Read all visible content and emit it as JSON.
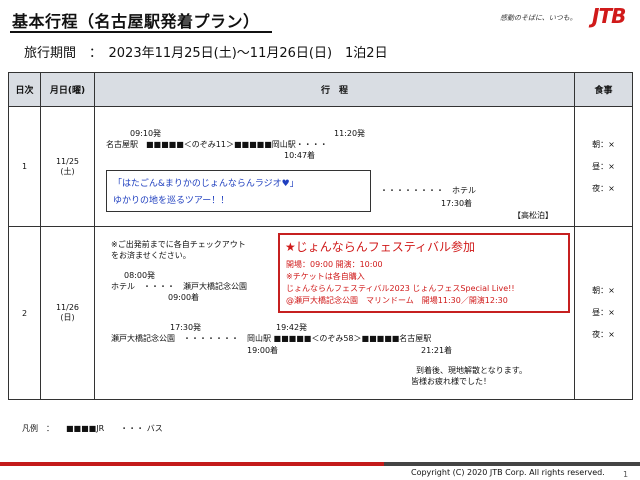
{
  "header": {
    "title": "基本行程（名古屋駅発着プラン）",
    "tagline": "感動のそばに、いつも。",
    "logo": "JTB",
    "period": "旅行期間　：　2023年11月25日(土)～11月26日(日)　1泊2日"
  },
  "table": {
    "headers": [
      "日次",
      "月日(曜)",
      "行　程",
      "食事"
    ],
    "day1": {
      "num": "1",
      "date": "11/25",
      "weekday": "(土)",
      "dep_time": "09:10発",
      "arr_time_top": "11:20発",
      "route": "名古屋駅　■■■■■＜のぞみ11＞■■■■■岡山駅・・・・",
      "arr_time": "10:47着",
      "promo_line1": "「はたごん&まりかのじょんならんラジオ♥」",
      "promo_line2": "ゆかりの地を巡るツアー！！",
      "hotel_route": "・・・・・・・・　ホテル",
      "hotel_time": "17:30着",
      "hotel_name": "【高松泊】",
      "meals": [
        "朝：×",
        "昼：×",
        "夜：×"
      ]
    },
    "day2": {
      "num": "2",
      "date": "11/26",
      "weekday": "(日)",
      "note_line1": "※ご出発前までに各自チェックアウト",
      "note_line2": "をお済ませください。",
      "morning_time": "08:00発",
      "morning_route": "ホテル　・・・・　瀬戸大橋記念公園",
      "morning_arr": "09:00着",
      "festival_title": "★じょんならんフェスティバル参加",
      "festival_line1": "開場：09:00 開演：10:00",
      "festival_line2": "※チケットは各自購入",
      "festival_line3": "じょんならんフェスティバル2023 じょんフェスSpecial Live!!",
      "festival_line4": "@瀬戸大橋記念公園　マリンドーム　開場11:30／開演12:30",
      "ret_dep1": "17:30発",
      "ret_dep2": "19:42発",
      "ret_route": "瀬戸大橋記念公園　・・・・・・・　岡山駅 ■■■■■＜のぞみ58＞■■■■■名古屋駅",
      "ret_arr1": "19:00着",
      "ret_arr2": "21:21着",
      "closing1": "到着後、現地解散となります。",
      "closing2": "皆様お疲れ様でした！",
      "meals": [
        "朝：×",
        "昼：×",
        "夜：×"
      ]
    }
  },
  "legend": "凡例　：　　■■■■JR　　・・・ バス",
  "footer": {
    "copyright": "Copyright (C) 2020 JTB Corp. All rights reserved.",
    "page": "1"
  },
  "colors": {
    "accent": "#d01a1a",
    "promo_text": "#1f3fbf",
    "header_bg": "#d9dde3"
  }
}
